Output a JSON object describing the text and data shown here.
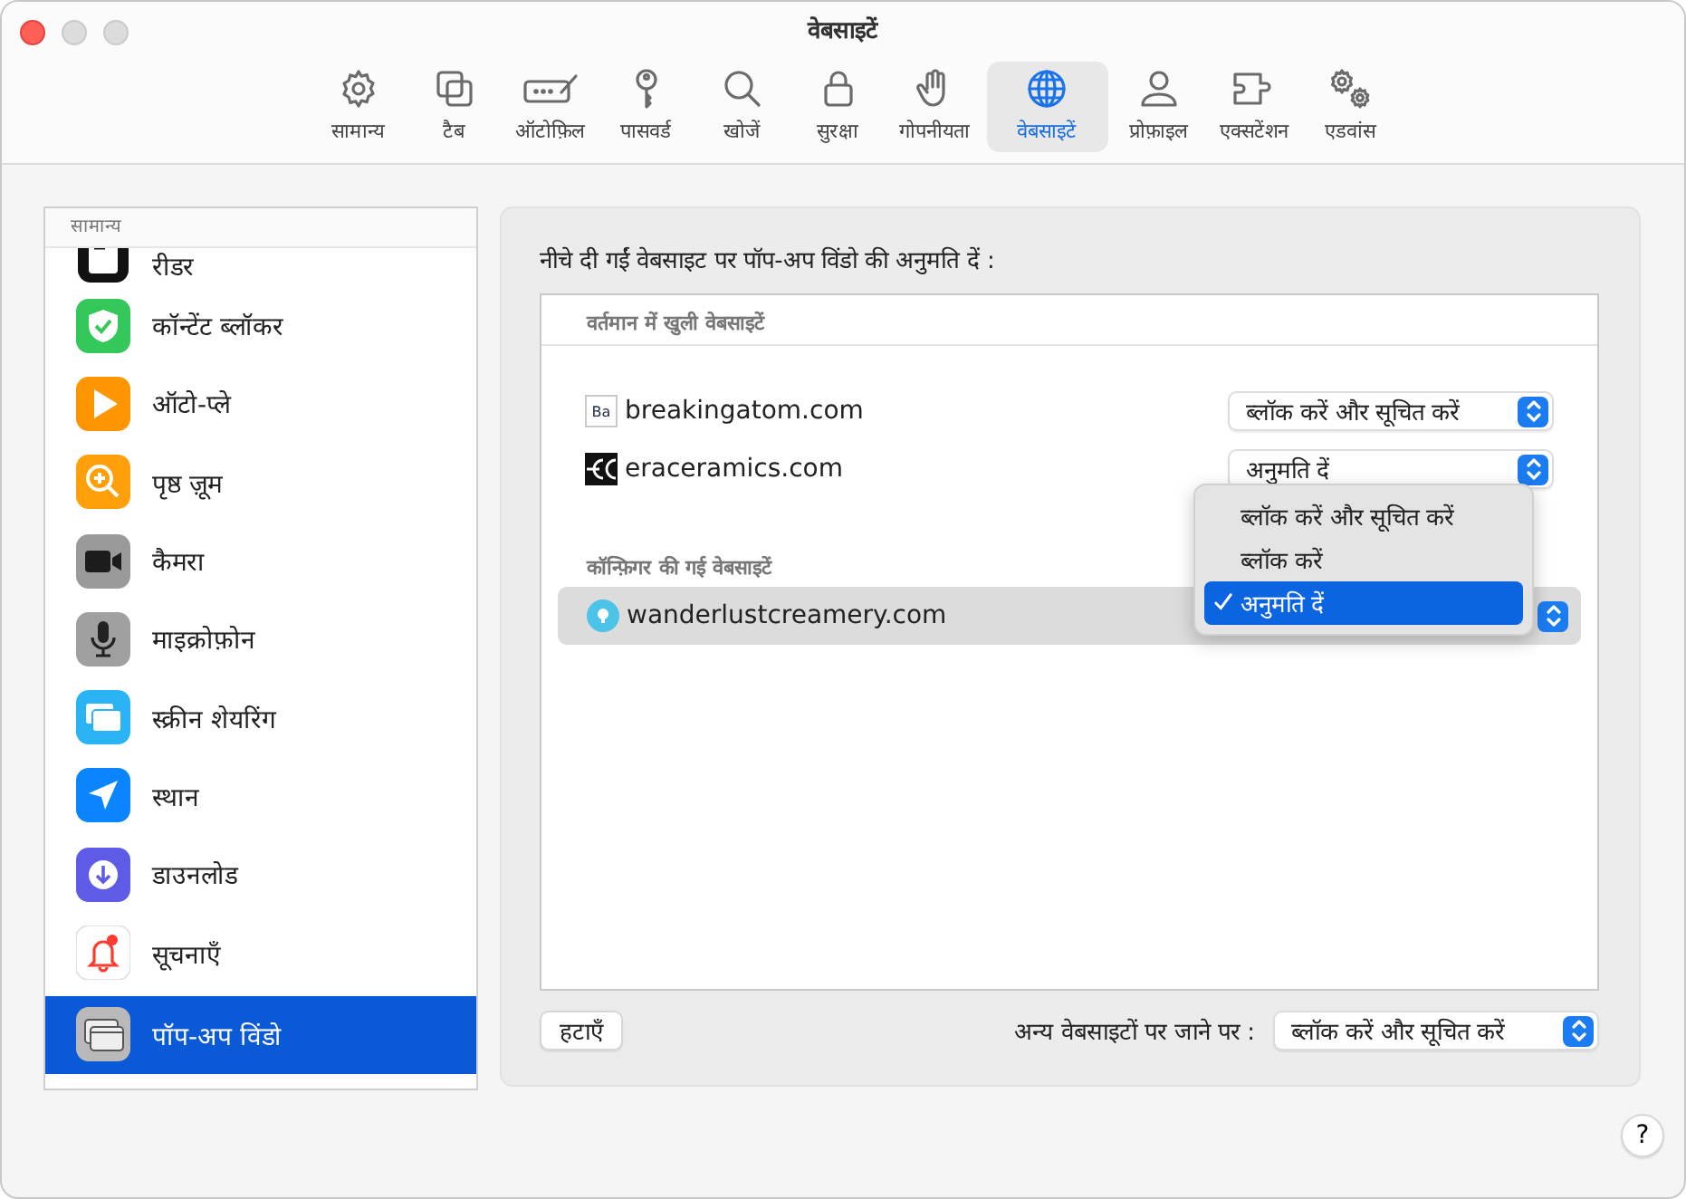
{
  "window": {
    "title": "वेबसाइटें"
  },
  "toolbar": [
    {
      "label": "सामान्य",
      "selected": false
    },
    {
      "label": "टैब",
      "selected": false
    },
    {
      "label": "ऑटोफ़िल",
      "selected": false
    },
    {
      "label": "पासवर्ड",
      "selected": false
    },
    {
      "label": "खोजें",
      "selected": false
    },
    {
      "label": "सुरक्षा",
      "selected": false
    },
    {
      "label": "गोपनीयता",
      "selected": false
    },
    {
      "label": "वेबसाइटें",
      "selected": true
    },
    {
      "label": "प्रोफ़ाइल",
      "selected": false
    },
    {
      "label": "एक्सटेंशन",
      "selected": false
    },
    {
      "label": "एडवांस",
      "selected": false
    }
  ],
  "sidebar": {
    "header": "सामान्य",
    "items": [
      {
        "label": "रीडर",
        "selected": false
      },
      {
        "label": "कॉन्टेंट ब्लॉकर",
        "selected": false
      },
      {
        "label": "ऑटो-प्ले",
        "selected": false
      },
      {
        "label": "पृष्ठ ज़ूम",
        "selected": false
      },
      {
        "label": "कैमरा",
        "selected": false
      },
      {
        "label": "माइक्रोफ़ोन",
        "selected": false
      },
      {
        "label": "स्क्रीन शेयरिंग",
        "selected": false
      },
      {
        "label": "स्थान",
        "selected": false
      },
      {
        "label": "डाउनलोड",
        "selected": false
      },
      {
        "label": "सूचनाएँ",
        "selected": false
      },
      {
        "label": "पॉप-अप विंडो",
        "selected": true
      }
    ]
  },
  "panel": {
    "heading": "नीचे दी गईं वेबसाइट पर पॉप-अप विंडो की अनुमति दें :",
    "current_section": "वर्तमान में खुली वेबसाइटें",
    "current_sites": [
      {
        "site": "breakingatom.com",
        "favicon_text": "Ba",
        "setting": "ब्लॉक करें और सूचित करें"
      },
      {
        "site": "eraceramics.com",
        "setting": "अनुमति दें"
      }
    ],
    "configured_section": "कॉन्फ़िगर की गई वेबसाइटें",
    "configured_sites": [
      {
        "site": "wanderlustcreamery.com",
        "selected": true
      }
    ],
    "menu": [
      {
        "label": "ब्लॉक करें और सूचित करें",
        "selected": false
      },
      {
        "label": "ब्लॉक करें",
        "selected": false
      },
      {
        "label": "अनुमति दें",
        "selected": true
      }
    ],
    "remove_button": "हटाएँ",
    "other_label": "अन्य वेबसाइटों पर जाने पर :",
    "other_setting": "ब्लॉक करें और सूचित करें"
  },
  "help_button": "?"
}
